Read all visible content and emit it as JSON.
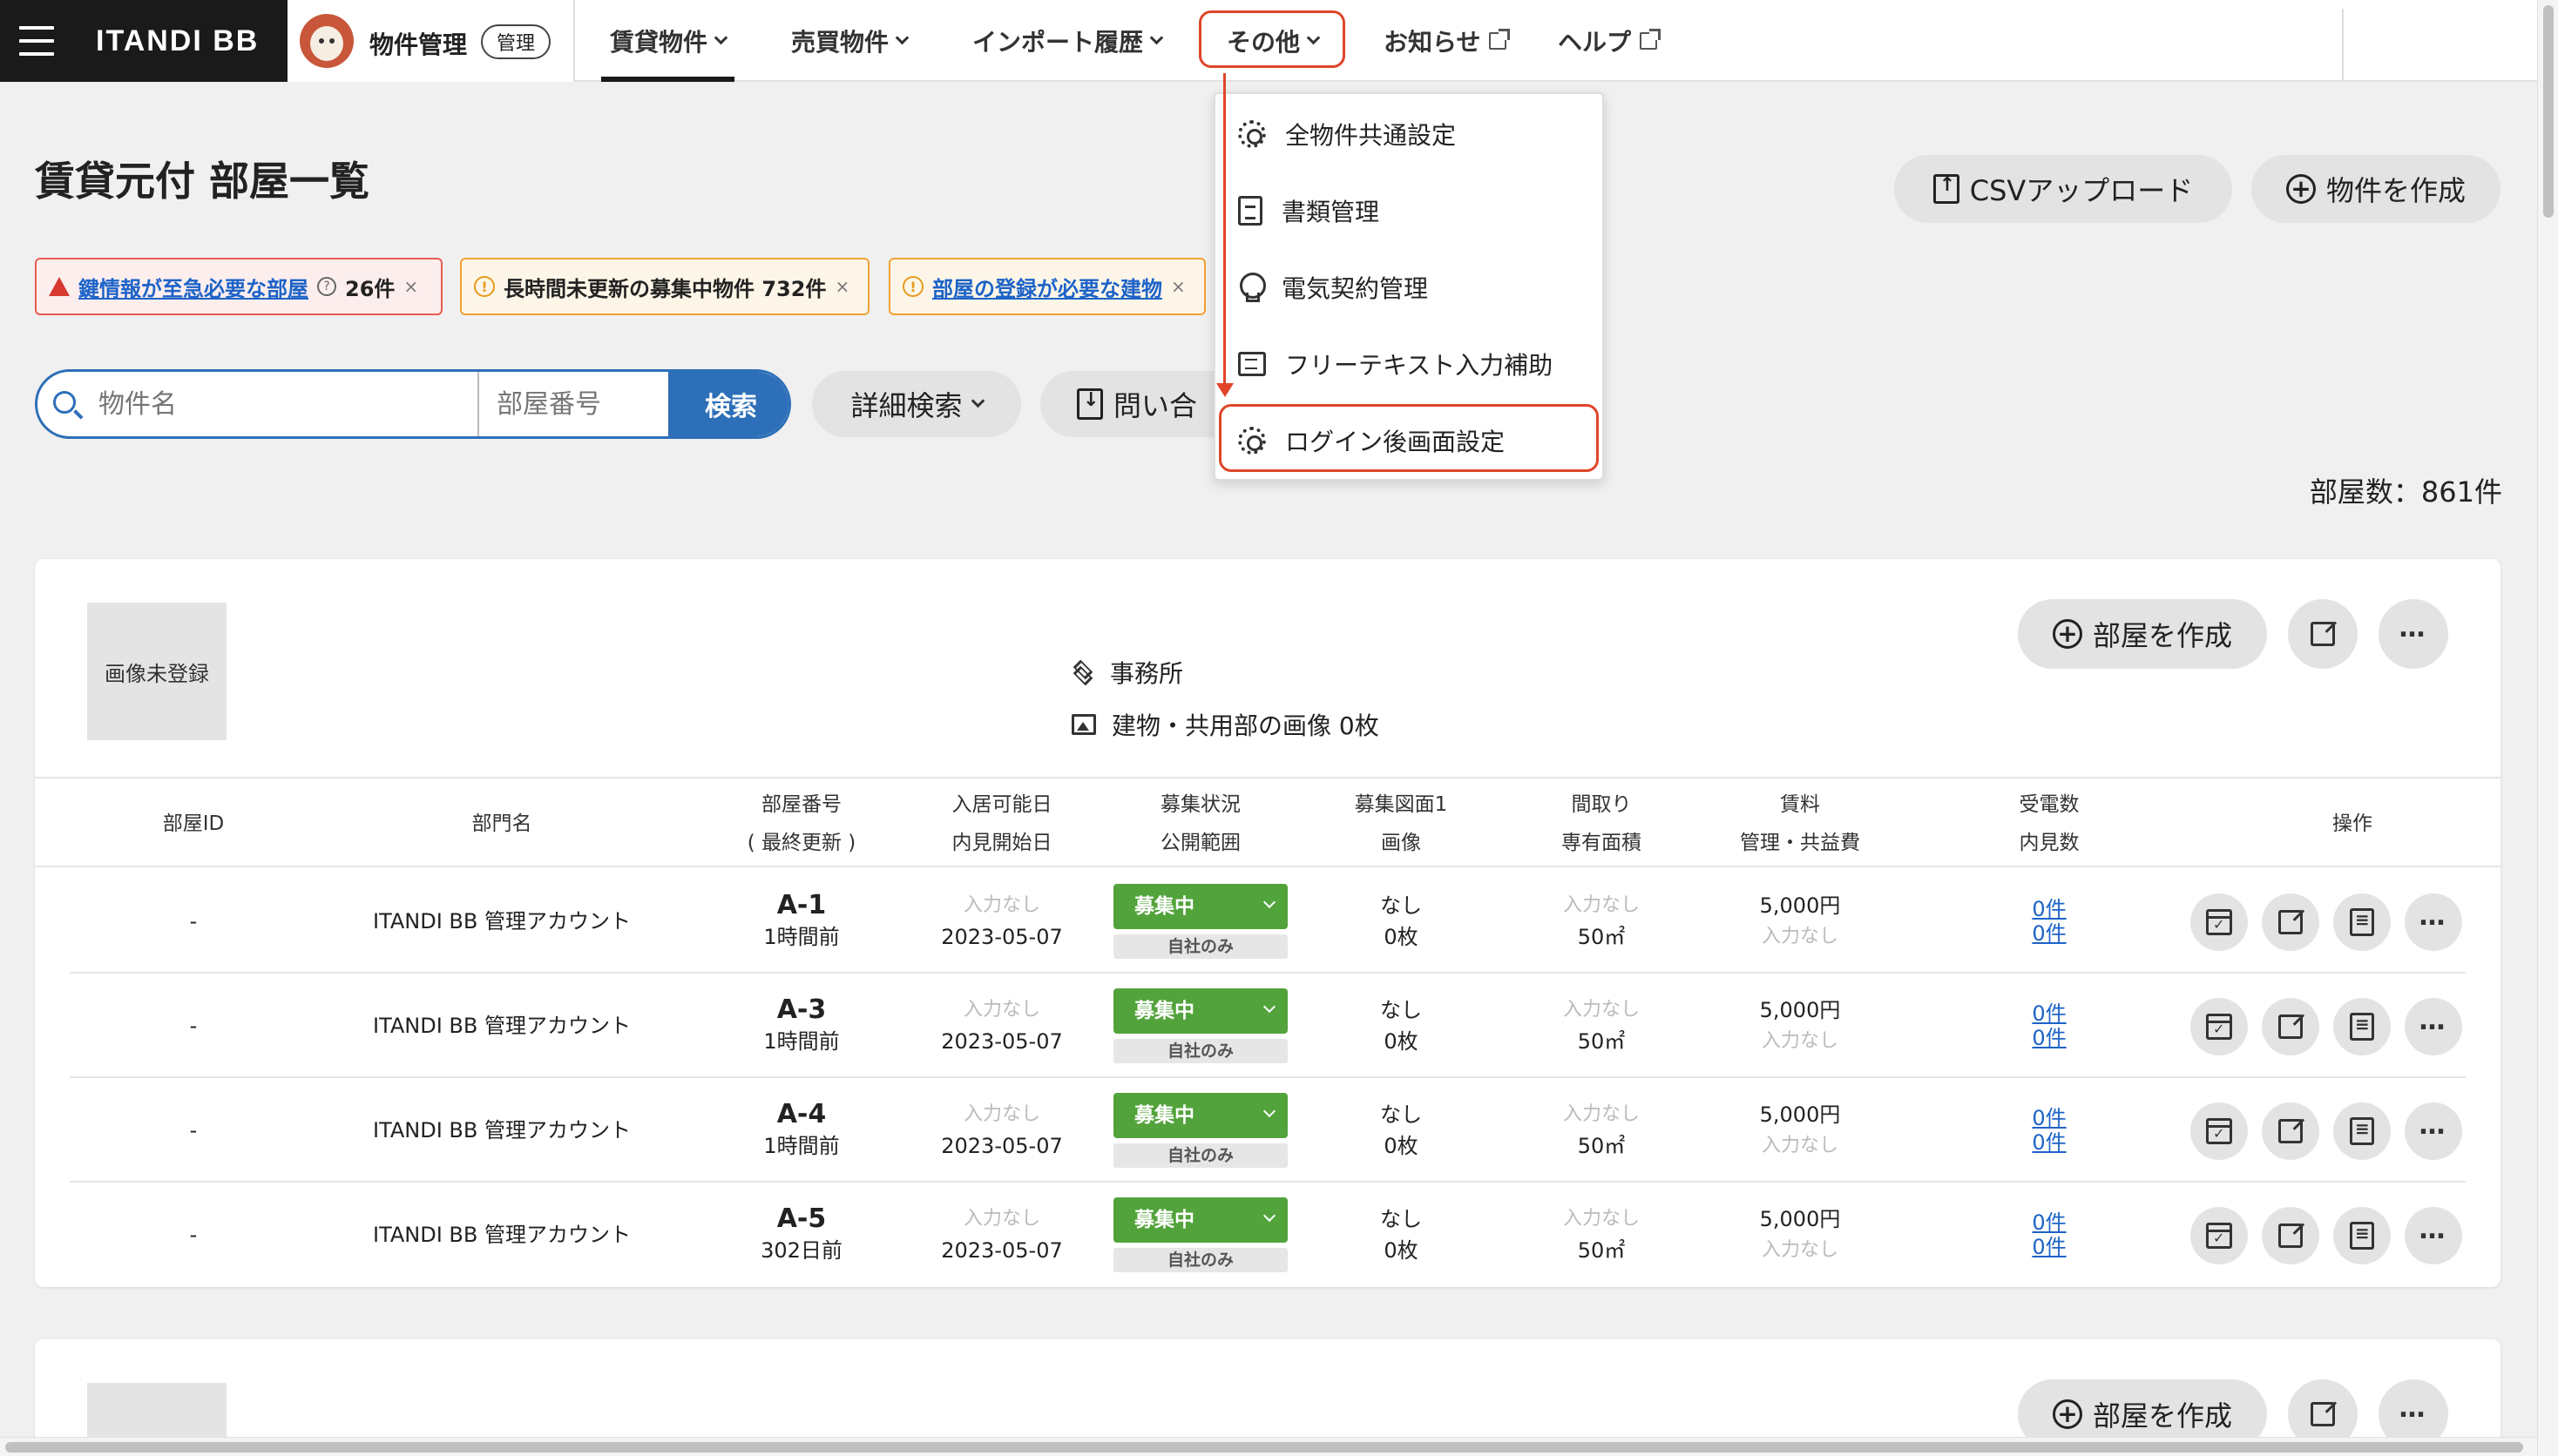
{
  "header": {
    "brand": "ITANDI BB",
    "app_name": "物件管理",
    "app_badge": "管理",
    "nav": [
      {
        "label": "賃貸物件"
      },
      {
        "label": "売買物件"
      },
      {
        "label": "インポート履歴"
      },
      {
        "label": "その他"
      },
      {
        "label": "お知らせ"
      },
      {
        "label": "ヘルプ"
      }
    ]
  },
  "dropdown": {
    "items": [
      {
        "label": "全物件共通設定",
        "icon": "gear-icon"
      },
      {
        "label": "書類管理",
        "icon": "document-icon"
      },
      {
        "label": "電気契約管理",
        "icon": "lightbulb-icon"
      },
      {
        "label": "フリーテキスト入力補助",
        "icon": "message-icon"
      },
      {
        "label": "ログイン後画面設定",
        "icon": "gear-icon"
      }
    ]
  },
  "page": {
    "title": "賃貸元付 部屋一覧",
    "csv_upload": "CSVアップロード",
    "create_property": "物件を作成",
    "room_count": "部屋数：861件"
  },
  "alerts": [
    {
      "link": "鍵情報が至急必要な部屋",
      "count": "26件"
    },
    {
      "text": "長時間未更新の募集中物件 732件"
    },
    {
      "link": "部屋の登録が必要な建物"
    }
  ],
  "search": {
    "name_placeholder": "物件名",
    "room_placeholder": "部屋番号",
    "search_button": "検索",
    "detail_search": "詳細検索",
    "inquiry": "問い合"
  },
  "property": {
    "image_placeholder": "画像未登録",
    "type": "事務所",
    "images": "建物・共用部の画像 0枚",
    "create_room": "部屋を作成"
  },
  "table": {
    "headers": [
      {
        "l1": "部屋ID",
        "l2": ""
      },
      {
        "l1": "部門名",
        "l2": ""
      },
      {
        "l1": "部屋番号",
        "l2": "( 最終更新 )"
      },
      {
        "l1": "入居可能日",
        "l2": "内見開始日"
      },
      {
        "l1": "募集状況",
        "l2": "公開範囲"
      },
      {
        "l1": "募集図面1",
        "l2": "画像"
      },
      {
        "l1": "間取り",
        "l2": "専有面積"
      },
      {
        "l1": "賃料",
        "l2": "管理・共益費"
      },
      {
        "l1": "受電数",
        "l2": "内見数"
      },
      {
        "l1": "操作",
        "l2": ""
      }
    ],
    "rows": [
      {
        "id": "-",
        "dept": "ITANDI BB 管理アカウント",
        "room": "A-1",
        "updated": "1時間前",
        "move_in": "入力なし",
        "viewing": "2023-05-07",
        "status": "募集中",
        "scope": "自社のみ",
        "plan": "なし",
        "images": "0枚",
        "layout": "入力なし",
        "area": "50㎡",
        "rent": "5,000円",
        "fee": "入力なし",
        "calls": "0件",
        "views": "0件"
      },
      {
        "id": "-",
        "dept": "ITANDI BB 管理アカウント",
        "room": "A-3",
        "updated": "1時間前",
        "move_in": "入力なし",
        "viewing": "2023-05-07",
        "status": "募集中",
        "scope": "自社のみ",
        "plan": "なし",
        "images": "0枚",
        "layout": "入力なし",
        "area": "50㎡",
        "rent": "5,000円",
        "fee": "入力なし",
        "calls": "0件",
        "views": "0件"
      },
      {
        "id": "-",
        "dept": "ITANDI BB 管理アカウント",
        "room": "A-4",
        "updated": "1時間前",
        "move_in": "入力なし",
        "viewing": "2023-05-07",
        "status": "募集中",
        "scope": "自社のみ",
        "plan": "なし",
        "images": "0枚",
        "layout": "入力なし",
        "area": "50㎡",
        "rent": "5,000円",
        "fee": "入力なし",
        "calls": "0件",
        "views": "0件"
      },
      {
        "id": "-",
        "dept": "ITANDI BB 管理アカウント",
        "room": "A-5",
        "updated": "302日前",
        "move_in": "入力なし",
        "viewing": "2023-05-07",
        "status": "募集中",
        "scope": "自社のみ",
        "plan": "なし",
        "images": "0枚",
        "layout": "入力なし",
        "area": "50㎡",
        "rent": "5,000円",
        "fee": "入力なし",
        "calls": "0件",
        "views": "0件"
      }
    ]
  },
  "colors": {
    "accent": "#2d6fb8",
    "status_green": "#52a33b",
    "highlight_red": "#e0452a",
    "alert_red": "#e85a4f",
    "alert_orange": "#f0a234"
  }
}
